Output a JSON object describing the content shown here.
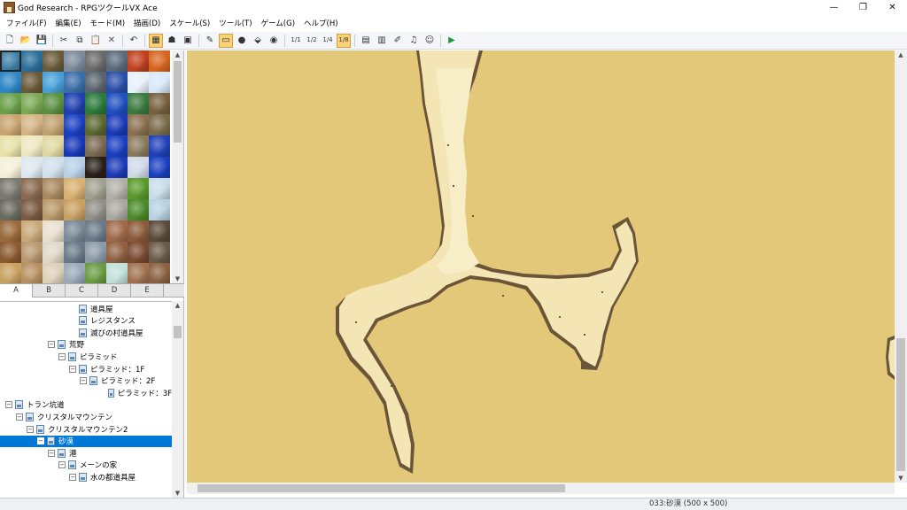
{
  "window": {
    "title": "God Research - RPGツクールVX Ace",
    "minimize_glyph": "—",
    "maximize_glyph": "❐",
    "close_glyph": "✕"
  },
  "menu": [
    "ファイル(F)",
    "編集(E)",
    "モード(M)",
    "描画(D)",
    "スケール(S)",
    "ツール(T)",
    "ゲーム(G)",
    "ヘルプ(H)"
  ],
  "toolbar": {
    "icons": [
      "new-project-icon",
      "open-project-icon",
      "save-project-icon",
      "cut-icon",
      "copy-icon",
      "paste-icon",
      "delete-icon",
      "undo-icon",
      "map-mode-icon",
      "event-mode-icon",
      "region-mode-icon",
      "pencil-icon",
      "rectangle-icon",
      "ellipse-icon",
      "fill-icon",
      "shadow-pen-icon",
      "scale-1-1-icon",
      "scale-1-2-icon",
      "scale-1-4-icon",
      "scale-1-8-icon",
      "database-icon",
      "resource-manager-icon",
      "script-editor-icon",
      "sound-test-icon",
      "character-generator-icon",
      "playtest-icon"
    ],
    "active": [
      "map-mode-icon",
      "rectangle-icon",
      "scale-1-8-icon"
    ],
    "scale_labels": [
      "1/1",
      "1/2",
      "1/4",
      "1/8"
    ]
  },
  "palette": {
    "tabs": [
      "A",
      "B",
      "C",
      "D",
      "E"
    ],
    "active_tab": "A",
    "selected_tile": 0
  },
  "tree": {
    "items": [
      {
        "label": "道具屋",
        "depth": 6,
        "expander": ""
      },
      {
        "label": "レジスタンス",
        "depth": 6,
        "expander": ""
      },
      {
        "label": "滅びの村道具屋",
        "depth": 6,
        "expander": ""
      },
      {
        "label": "荒野",
        "depth": 4,
        "expander": "−"
      },
      {
        "label": "ピラミッド",
        "depth": 5,
        "expander": "−"
      },
      {
        "label": "ピラミッド：1F",
        "depth": 6,
        "expander": "−"
      },
      {
        "label": "ピラミッド：2F",
        "depth": 7,
        "expander": "−"
      },
      {
        "label": "ピラミッド：3F",
        "depth": 9,
        "expander": ""
      },
      {
        "label": "トラン坑道",
        "depth": 0,
        "expander": "−"
      },
      {
        "label": "クリスタルマウンテン",
        "depth": 1,
        "expander": "−"
      },
      {
        "label": "クリスタルマウンテン2",
        "depth": 2,
        "expander": "−"
      },
      {
        "label": "砂漠",
        "depth": 3,
        "expander": "−",
        "selected": true
      },
      {
        "label": "港",
        "depth": 4,
        "expander": "−"
      },
      {
        "label": "メーンの家",
        "depth": 5,
        "expander": "−"
      },
      {
        "label": "水の都道具屋",
        "depth": 6,
        "expander": "−"
      }
    ]
  },
  "status": "033:砂漠 (500 x 500)",
  "colors": {
    "sand": "#e4c879",
    "path": "#f3e6b4",
    "edge": "#6b5538",
    "selection": "#0078d7"
  }
}
